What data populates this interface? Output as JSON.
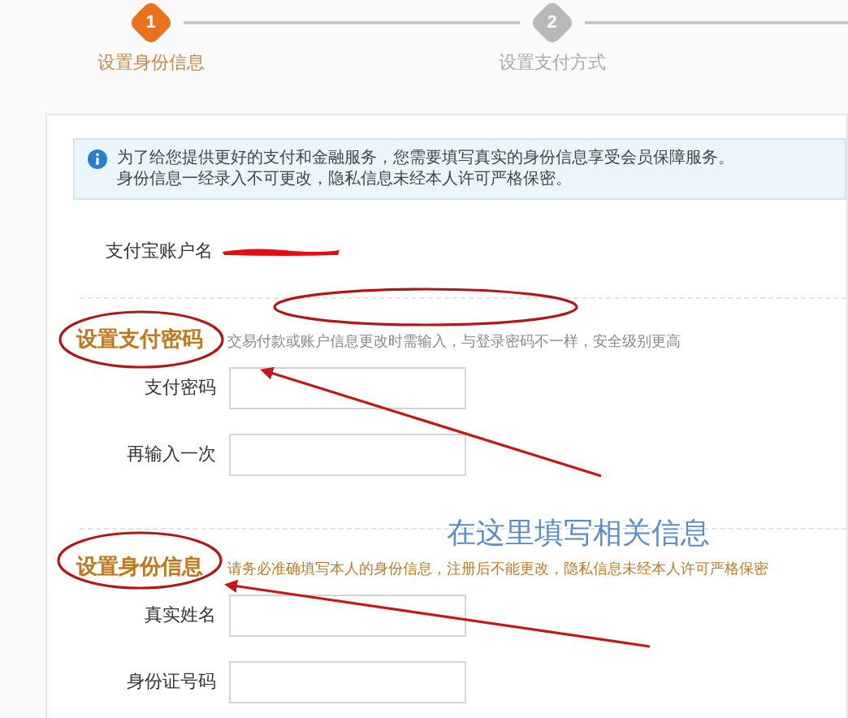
{
  "steps": [
    {
      "number": "1",
      "label": "设置身份信息",
      "selected": true
    },
    {
      "number": "2",
      "label": "设置支付方式",
      "selected": false
    }
  ],
  "notice": [
    "为了给您提供更好的支付和金融服务，您需要填写真实的身份信息享受会员保障服务。",
    "身份信息一经录入不可更改，隐私信息未经本人许可严格保密。"
  ],
  "account": {
    "label": "支付宝账户名"
  },
  "sections": [
    {
      "title": "设置支付密码",
      "note": "交易付款或账户信息更改时需输入，与登录密码不一样，安全级别更高",
      "fields": [
        {
          "label": "支付密码"
        },
        {
          "label": "再输入一次"
        }
      ]
    },
    {
      "title": "设置身份信息",
      "note": "请务必准确填写本人的身份信息，注册后不能更改，隐私信息未经本人许可严格保密",
      "fields": [
        {
          "label": "真实姓名"
        },
        {
          "label": "身份证号码"
        }
      ]
    }
  ],
  "annotation": "在这里填写相关信息"
}
